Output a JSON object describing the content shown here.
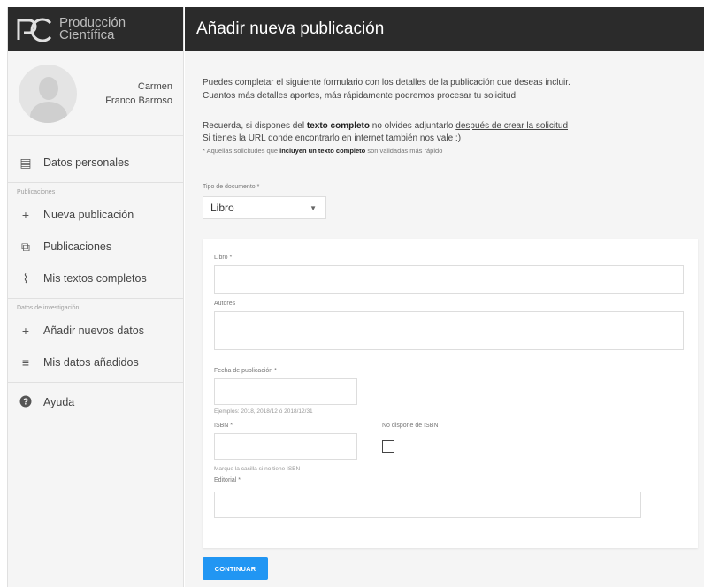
{
  "brand": {
    "line1": "Producción",
    "line2": "Científica"
  },
  "profile": {
    "first_name": "Carmen",
    "last_name": "Franco Barroso"
  },
  "nav": {
    "personal": {
      "label": "Datos personales",
      "icon": "id-card-icon"
    },
    "section_publications": "Publicaciones",
    "new_publication": {
      "label": "Nueva publicación",
      "icon": "plus-icon"
    },
    "publications": {
      "label": "Publicaciones",
      "icon": "library-icon"
    },
    "full_texts": {
      "label": "Mis textos completos",
      "icon": "attachment-icon"
    },
    "section_research": "Datos de investigación",
    "add_data": {
      "label": "Añadir nuevos datos",
      "icon": "plus-icon"
    },
    "my_data": {
      "label": "Mis datos añadidos",
      "icon": "list-icon"
    },
    "help": {
      "label": "Ayuda",
      "icon": "help-icon"
    }
  },
  "header": {
    "title": "Añadir nueva publicación"
  },
  "intro": {
    "line1": "Puedes completar el siguiente formulario con los detalles de la publicación que deseas incluir.",
    "line2": "Cuantos más detalles aportes, más rápidamente podremos procesar tu solicitud.",
    "r1_a": "Recuerda, si dispones del ",
    "r1_b": "texto completo",
    "r1_c": " no olvides adjuntarlo ",
    "r1_d": "después de crear la solicitud",
    "r2": "Si tienes la URL donde encontrarlo en internet también nos vale :)",
    "r3_a": "* Aquellas solicitudes que ",
    "r3_b": "incluyen un texto completo",
    "r3_c": " son validadas más rápido"
  },
  "doctype": {
    "label": "Tipo de documento *",
    "value": "Libro"
  },
  "form": {
    "book_label": "Libro *",
    "book_value": "",
    "authors_label": "Autores",
    "authors_value": "",
    "date_label": "Fecha de publicación *",
    "date_value": "",
    "date_hint": "Ejemplos: 2018, 2018/12 ó 2018/12/31",
    "isbn_label": "ISBN *",
    "isbn_value": "",
    "isbn_hint": "Marque la casilla si no tiene ISBN",
    "no_isbn_label": "No dispone de ISBN",
    "no_isbn_checked": false,
    "publisher_label": "Editorial *",
    "publisher_value": ""
  },
  "actions": {
    "continue_label": "CONTINUAR"
  },
  "colors": {
    "header_bg": "#2b2b2b",
    "accent": "#2196f3",
    "sidebar_bg": "#f5f5f5"
  }
}
